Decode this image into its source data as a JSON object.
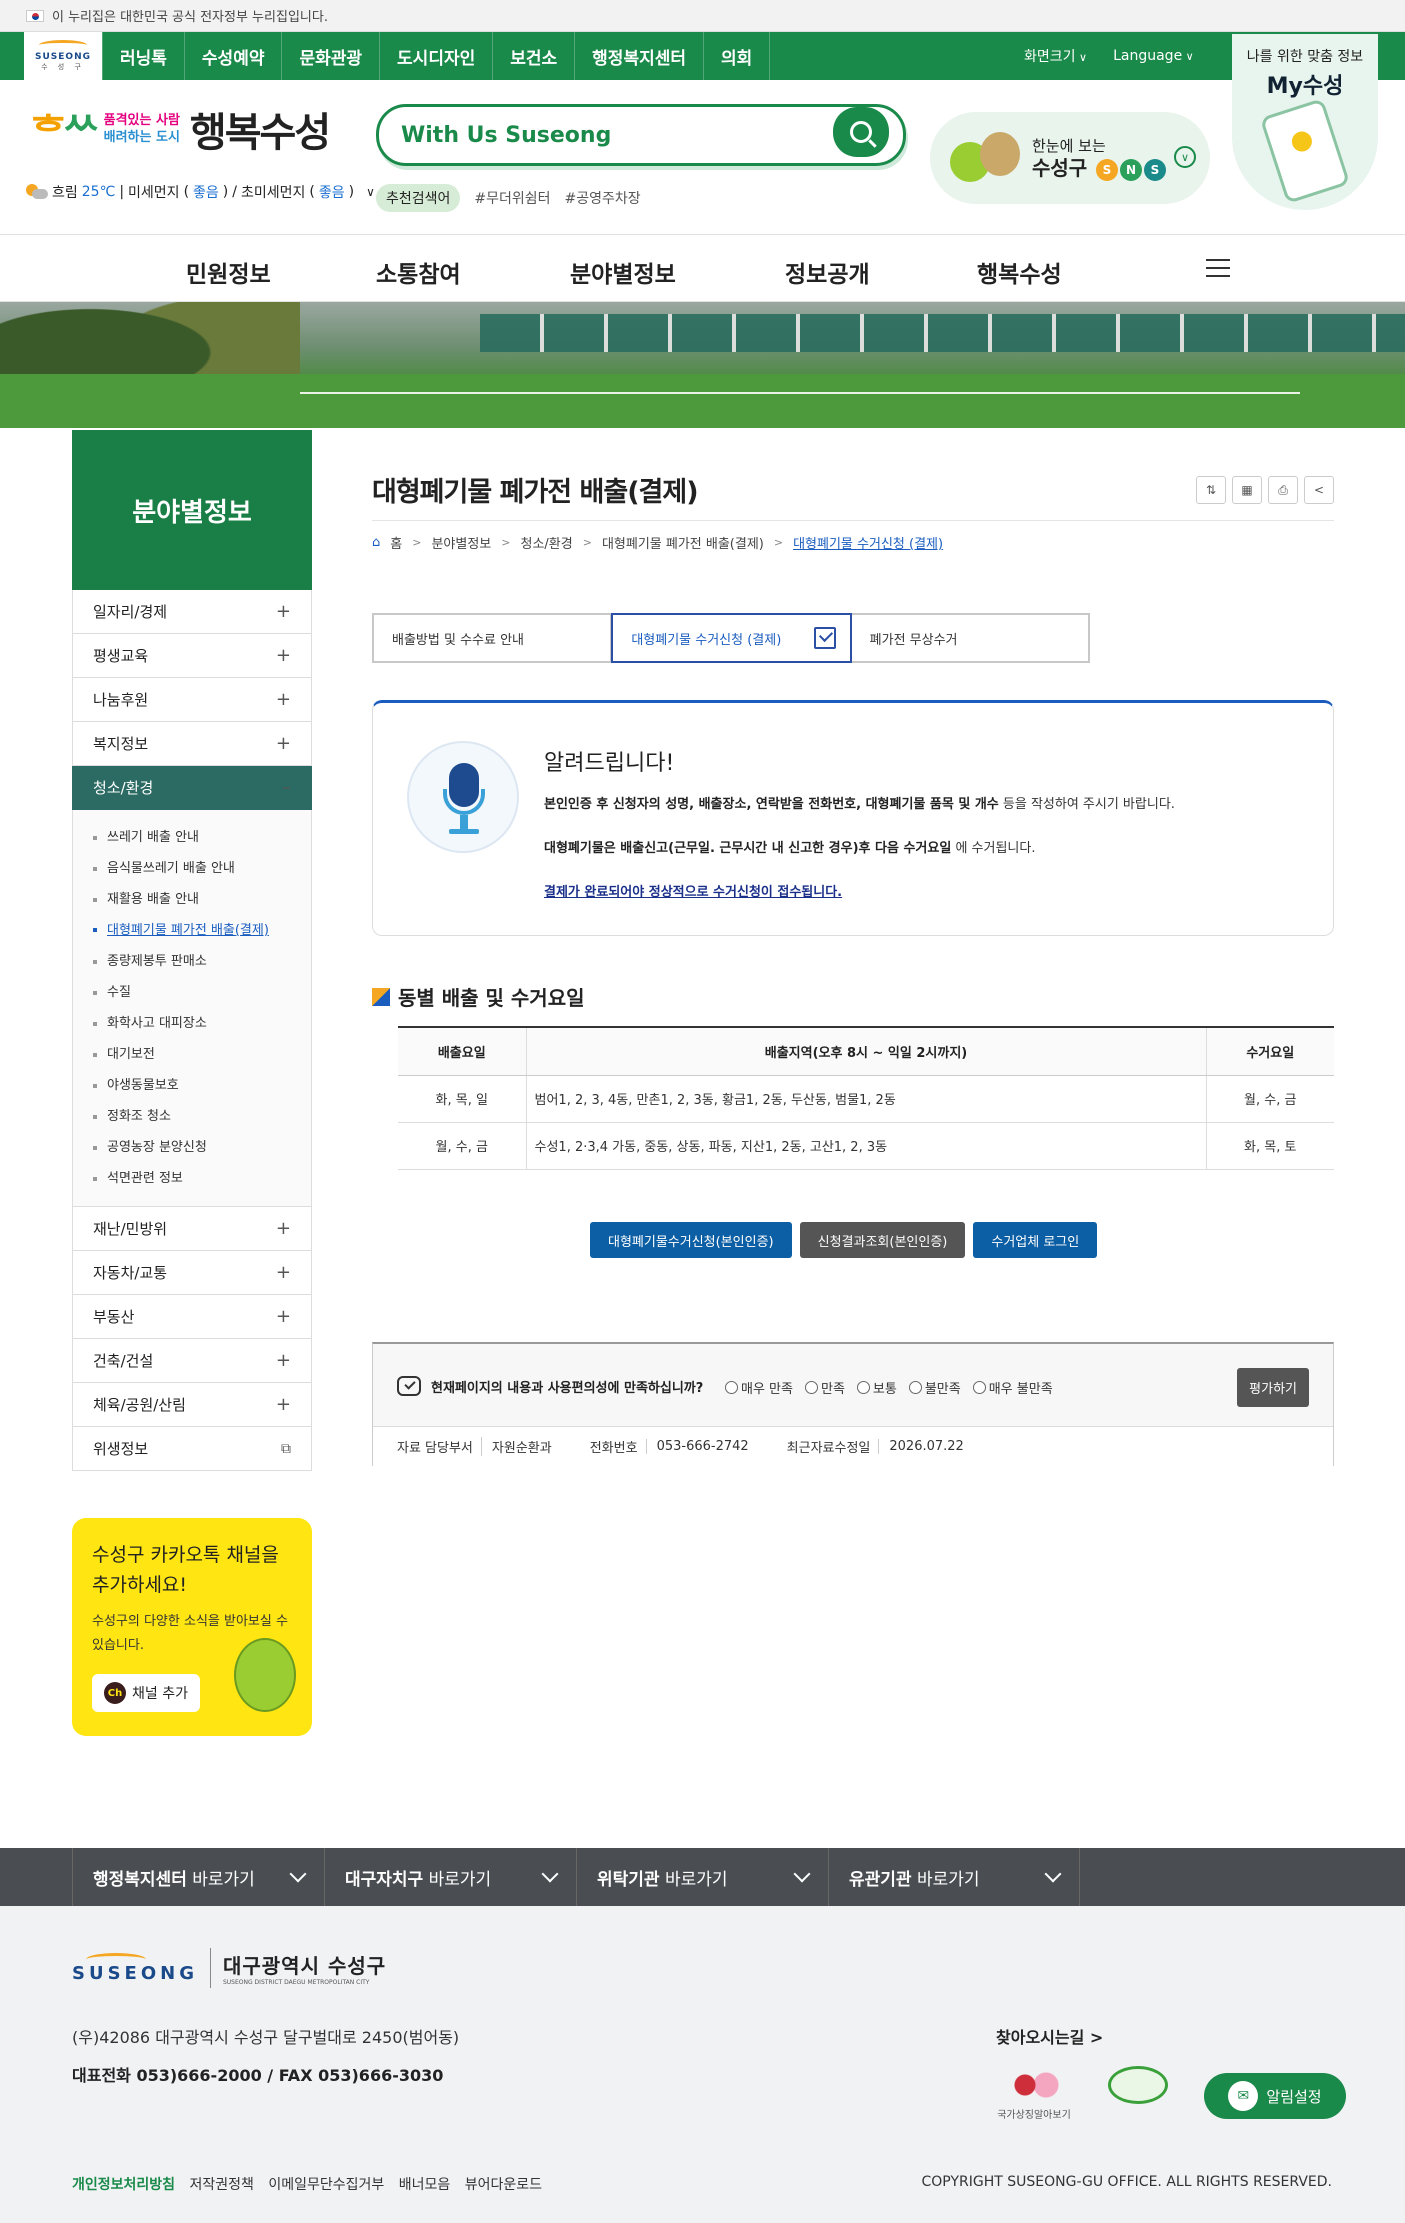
{
  "gov_banner": "이 누리집은 대한민국 공식 전자정부 누리집입니다.",
  "logo": {
    "en": "SUSEONG",
    "ko": "수 성 구"
  },
  "top_nav": [
    "러닝톡",
    "수성예약",
    "문화관광",
    "도시디자인",
    "보건소",
    "행정복지센터",
    "의회"
  ],
  "utility": {
    "font_size": "화면크기",
    "language": "Language"
  },
  "my_card": {
    "line1": "나를 위한 맞춤 정보",
    "line2": "My수성"
  },
  "brand": {
    "mark_a": "ᄒ",
    "mark_b": "ᄊ",
    "slogan_a": "품격있는 사람",
    "slogan_b": "배려하는 도시",
    "name": "행복수성"
  },
  "weather": {
    "state": "흐림",
    "temp": "25℃",
    "dust_label": "미세먼지",
    "dust_value": "좋음",
    "fine_label": "초미세먼지",
    "fine_value": "좋음"
  },
  "search": {
    "placeholder": "With Us Suseong"
  },
  "keywords": [
    "추천검색어",
    "#무더위쉼터",
    "#공영주차장"
  ],
  "sns": {
    "line1": "한눈에 보는",
    "line2": "수성구",
    "letters": [
      "S",
      "N",
      "S"
    ]
  },
  "gnb": [
    "민원정보",
    "소통참여",
    "분야별정보",
    "정보공개",
    "행복수성"
  ],
  "lnb": {
    "title": "분야별정보",
    "items_top": [
      "일자리/경제",
      "평생교육",
      "나눔후원",
      "복지정보"
    ],
    "active": "청소/환경",
    "sub": [
      "쓰레기 배출 안내",
      "음식물쓰레기 배출 안내",
      "재활용 배출 안내",
      "대형폐기물 폐가전 배출(결제)",
      "종량제봉투 판매소",
      "수질",
      "화학사고 대피장소",
      "대기보전",
      "야생동물보호",
      "정화조 청소",
      "공영농장 분양신청",
      "석면관련 정보"
    ],
    "items_bottom": [
      "재난/민방위",
      "자동차/교통",
      "부동산",
      "건축/건설",
      "체육/공원/산림",
      "위생정보"
    ]
  },
  "kakao": {
    "title": "수성구 카카오톡 채널을 추가하세요!",
    "desc": "수성구의 다양한 소식을 받아보실 수 있습니다.",
    "button": "채널 추가",
    "ch": "Ch"
  },
  "page": {
    "title": "대형폐기물 폐가전 배출(결제)",
    "breadcrumb": [
      "홈",
      "분야별정보",
      "청소/환경",
      "대형폐기물 폐가전 배출(결제)",
      "대형폐기물 수거신청 (결제)"
    ],
    "tabs": [
      "배출방법 및 수수료 안내",
      "대형폐기물 수거신청 (결제)",
      "폐가전 무상수거"
    ]
  },
  "notice": {
    "heading": "알려드립니다!",
    "p1_bold": "본인인증 후 신청자의 성명, 배출장소, 연락받을 전화번호, 대형폐기물 품목 및 개수",
    "p1_rest": " 등을 작성하여 주시기 바랍니다.",
    "p2_bold_a": "대형폐기물은 배출신고(근무일. 근무시간 내 신고한 경우)후 다음 수거요일",
    "p2_rest": " 에 수거됩니다.",
    "p3": "결제가 완료되어야 정상적으로 수거신청이 접수됩니다."
  },
  "schedule": {
    "title": "동별 배출 및 수거요일",
    "headers": [
      "배출요일",
      "배출지역(오후 8시 ~ 익일 2시까지)",
      "수거요일"
    ],
    "rows": [
      [
        "화, 목, 일",
        "범어1, 2, 3, 4동, 만촌1, 2, 3동, 황금1, 2동, 두산동, 범물1, 2동",
        "월, 수, 금"
      ],
      [
        "월, 수, 금",
        "수성1, 2·3,4 가동, 중동, 상동, 파동, 지산1, 2동, 고산1, 2, 3동",
        "화, 목, 토"
      ]
    ]
  },
  "actions": [
    "대형폐기물수거신청(본인인증)",
    "신청결과조회(본인인증)",
    "수거업체 로그인"
  ],
  "survey": {
    "question": "현재페이지의 내용과 사용편의성에 만족하십니까?",
    "options": [
      "매우 만족",
      "만족",
      "보통",
      "불만족",
      "매우 불만족"
    ],
    "button": "평가하기",
    "dept_label": "자료 담당부서",
    "dept_value": "자원순환과",
    "tel_label": "전화번호",
    "tel_value": "053-666-2742",
    "updated_label": "최근자료수정일",
    "updated_value": "2026.07.22"
  },
  "footer_bar": [
    {
      "strong": "행정복지센터",
      "rest": " 바로가기"
    },
    {
      "strong": "대구자치구",
      "rest": " 바로가기"
    },
    {
      "strong": "위탁기관",
      "rest": " 바로가기"
    },
    {
      "strong": "유관기관",
      "rest": " 바로가기"
    }
  ],
  "footer": {
    "logo_en": "SUSEONG",
    "city": "대구광역시 수성구",
    "city_en": "SUSEONG DISTRICT DAEGU METROPOLITAN CITY",
    "address": "(우)42086 대구광역시 수성구 달구벌대로 2450(범어동)",
    "tel": "대표전화  053)666-2000  /  FAX  053)666-3030",
    "visit": "찾아오시는길 >",
    "mark1": "국가상징알아보기",
    "alarm": "알림설정",
    "links": [
      "개인정보처리방침",
      "저작권정책",
      "이메일무단수집거부",
      "배너모음",
      "뷰어다운로드"
    ],
    "copyright": "COPYRIGHT SUSEONG-GU OFFICE. ALL RIGHTS RESERVED."
  }
}
